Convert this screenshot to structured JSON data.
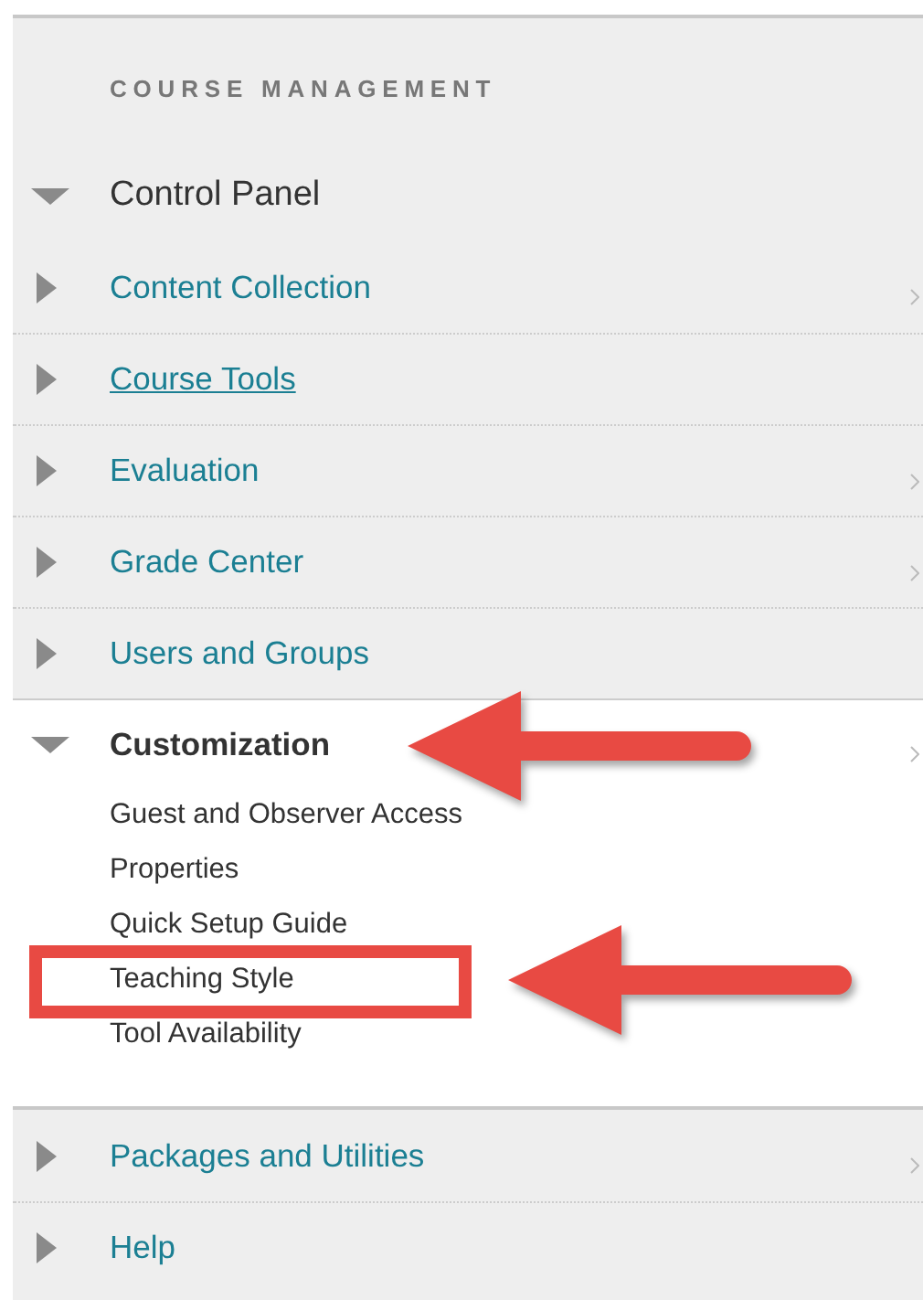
{
  "heading": "COURSE MANAGEMENT",
  "control_panel": {
    "label": "Control Panel",
    "expanded": true
  },
  "sections": [
    {
      "label": "Content Collection",
      "expanded": false,
      "submenu": true,
      "hovered": false,
      "arrow": false
    },
    {
      "label": "Course Tools",
      "expanded": false,
      "submenu": false,
      "hovered": true,
      "arrow": false
    },
    {
      "label": "Evaluation",
      "expanded": false,
      "submenu": true,
      "hovered": false,
      "arrow": false
    },
    {
      "label": "Grade Center",
      "expanded": false,
      "submenu": true,
      "hovered": false,
      "arrow": false
    },
    {
      "label": "Users and Groups",
      "expanded": false,
      "submenu": false,
      "hovered": false,
      "arrow": false
    },
    {
      "label": "Customization",
      "expanded": true,
      "submenu": true,
      "hovered": false,
      "arrow": true,
      "children": [
        {
          "label": "Guest and Observer Access",
          "boxed": false,
          "arrow": false
        },
        {
          "label": "Properties",
          "boxed": false,
          "arrow": false
        },
        {
          "label": "Quick Setup Guide",
          "boxed": false,
          "arrow": false
        },
        {
          "label": "Teaching Style",
          "boxed": true,
          "arrow": true
        },
        {
          "label": "Tool Availability",
          "boxed": false,
          "arrow": false
        }
      ]
    },
    {
      "label": "Packages and Utilities",
      "expanded": false,
      "submenu": true,
      "hovered": false,
      "arrow": false
    },
    {
      "label": "Help",
      "expanded": false,
      "submenu": false,
      "hovered": false,
      "arrow": false
    }
  ]
}
